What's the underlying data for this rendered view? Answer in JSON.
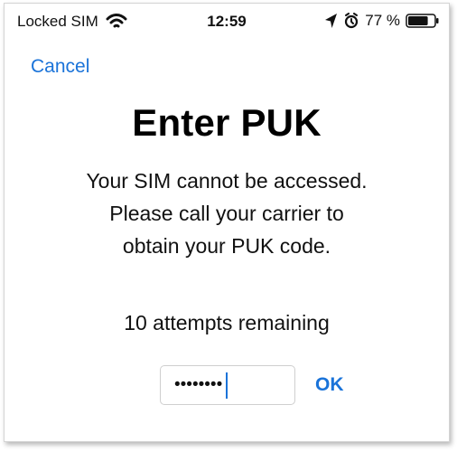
{
  "status_bar": {
    "carrier": "Locked SIM",
    "time": "12:59",
    "battery_percent": "77 %",
    "battery_level": 0.77,
    "icons": [
      "wifi-icon",
      "location-icon",
      "alarm-icon",
      "battery-icon"
    ]
  },
  "nav": {
    "cancel_label": "Cancel"
  },
  "main": {
    "title": "Enter PUK",
    "message_lines": [
      "Your SIM cannot be accessed.",
      "Please call your carrier to",
      "obtain your PUK code."
    ],
    "attempts": "10 attempts remaining"
  },
  "puk": {
    "value": "••••••••",
    "ok_label": "OK"
  },
  "colors": {
    "accent": "#1a73d9",
    "text": "#111111",
    "border": "#cfcfcf"
  }
}
